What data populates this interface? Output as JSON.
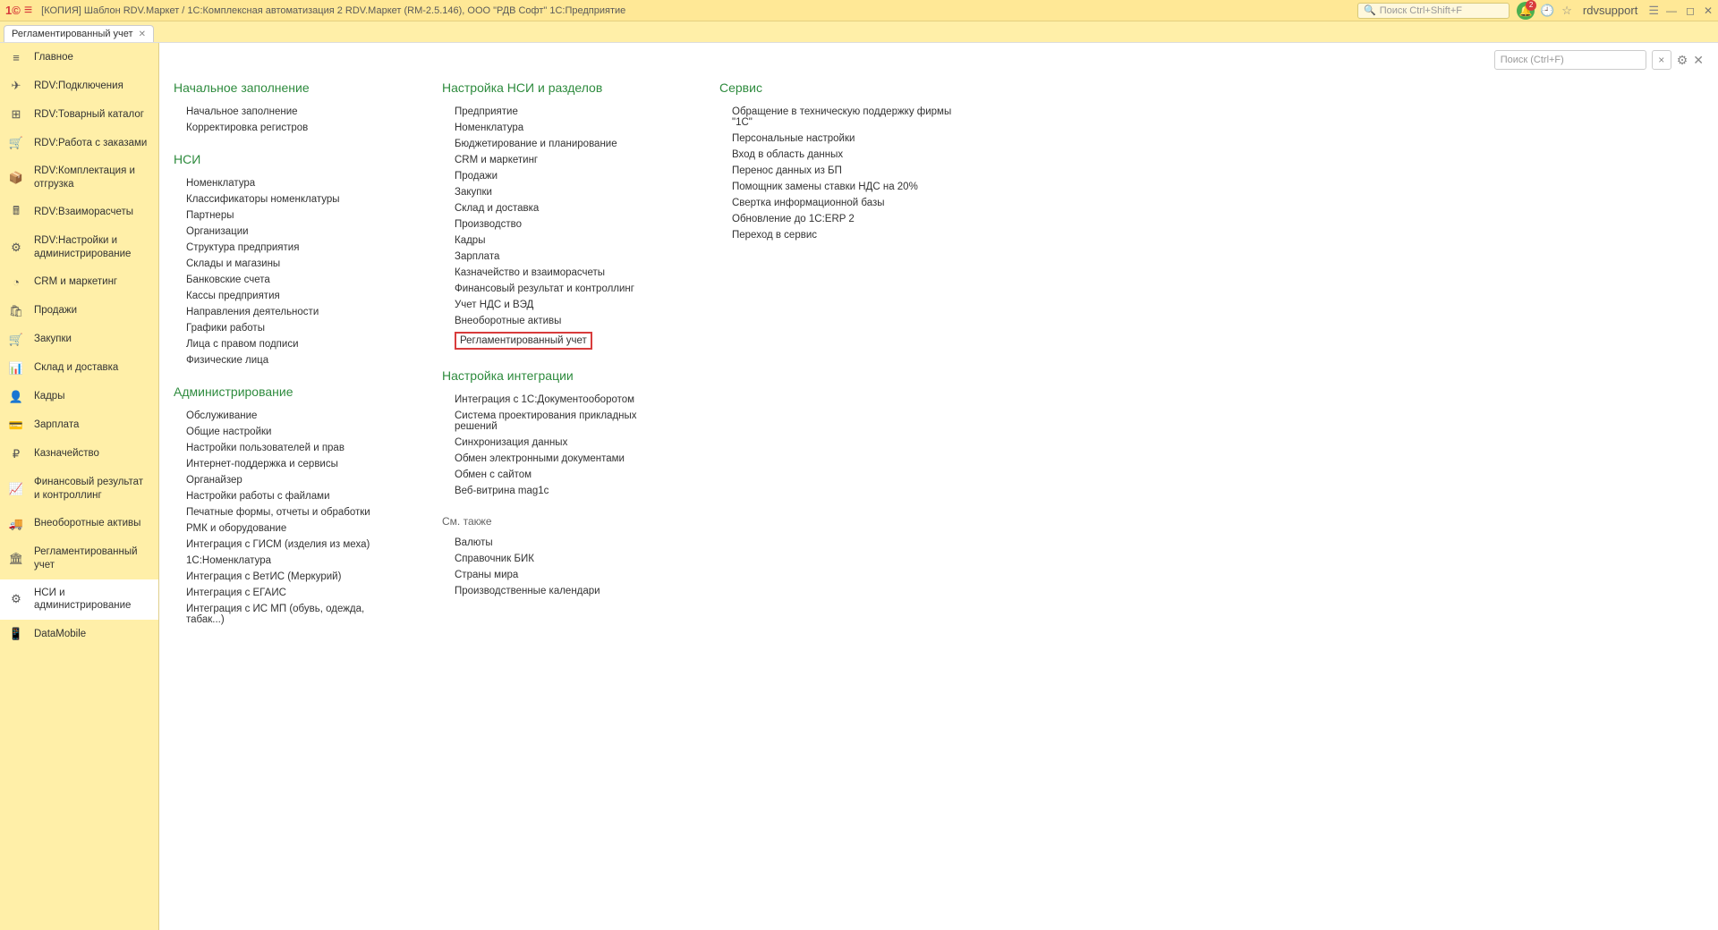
{
  "title": "[КОПИЯ] Шаблон RDV.Маркет / 1С:Комплексная автоматизация 2 RDV.Маркет (RM-2.5.146), ООО \"РДВ Софт\" 1С:Предприятие",
  "searchPlaceholderTop": "Поиск Ctrl+Shift+F",
  "bellBadge": "2",
  "user": "rdvsupport",
  "tab": {
    "label": "Регламентированный учет"
  },
  "contentSearchPlaceholder": "Поиск (Ctrl+F)",
  "sidebar": [
    {
      "label": "Главное",
      "icon": "≡"
    },
    {
      "label": "RDV:Подключения",
      "icon": "✈"
    },
    {
      "label": "RDV:Товарный каталог",
      "icon": "⊞"
    },
    {
      "label": "RDV:Работа с заказами",
      "icon": "🛒"
    },
    {
      "label": "RDV:Комплектация и отгрузка",
      "icon": "📦"
    },
    {
      "label": "RDV:Взаиморасчеты",
      "icon": "🖩"
    },
    {
      "label": "RDV:Настройки и администрирование",
      "icon": "⚙"
    },
    {
      "label": "CRM и маркетинг",
      "icon": "◔"
    },
    {
      "label": "Продажи",
      "icon": "🛍"
    },
    {
      "label": "Закупки",
      "icon": "🛒"
    },
    {
      "label": "Склад и доставка",
      "icon": "📊"
    },
    {
      "label": "Кадры",
      "icon": "👤"
    },
    {
      "label": "Зарплата",
      "icon": "💳"
    },
    {
      "label": "Казначейство",
      "icon": "₽"
    },
    {
      "label": "Финансовый результат и контроллинг",
      "icon": "📈"
    },
    {
      "label": "Внеоборотные активы",
      "icon": "🚚"
    },
    {
      "label": "Регламентированный учет",
      "icon": "🏛"
    },
    {
      "label": "НСИ и администрирование",
      "icon": "⚙"
    },
    {
      "label": "DataMobile",
      "icon": "📱"
    }
  ],
  "sidebarActiveIndex": 17,
  "sections": {
    "col1": [
      {
        "title": "Начальное заполнение",
        "items": [
          "Начальное заполнение",
          "Корректировка регистров"
        ]
      },
      {
        "title": "НСИ",
        "items": [
          "Номенклатура",
          "Классификаторы номенклатуры",
          "Партнеры",
          "Организации",
          "Структура предприятия",
          "Склады и магазины",
          "Банковские счета",
          "Кассы предприятия",
          "Направления деятельности",
          "Графики работы",
          "Лица с правом подписи",
          "Физические лица"
        ]
      },
      {
        "title": "Администрирование",
        "items": [
          "Обслуживание",
          "Общие настройки",
          "Настройки пользователей и прав",
          "Интернет-поддержка и сервисы",
          "Органайзер",
          "Настройки работы с файлами",
          "Печатные формы, отчеты и обработки",
          "РМК и оборудование",
          "Интеграция с ГИСМ (изделия из меха)",
          "1С:Номенклатура",
          "Интеграция с ВетИС (Меркурий)",
          "Интеграция с ЕГАИС",
          "Интеграция с ИС МП (обувь, одежда, табак...)"
        ]
      }
    ],
    "col2": [
      {
        "title": "Настройка НСИ и разделов",
        "items": [
          "Предприятие",
          "Номенклатура",
          "Бюджетирование и планирование",
          "CRM и маркетинг",
          "Продажи",
          "Закупки",
          "Склад и доставка",
          "Производство",
          "Кадры",
          "Зарплата",
          "Казначейство и взаиморасчеты",
          "Финансовый результат и контроллинг",
          "Учет НДС и ВЭД",
          "Внеоборотные активы",
          "Регламентированный учет"
        ]
      },
      {
        "title": "Настройка интеграции",
        "items": [
          "Интеграция с 1С:Документооборотом",
          "Система проектирования прикладных решений",
          "Синхронизация данных",
          "Обмен электронными документами",
          "Обмен с сайтом",
          "Веб-витрина mag1c"
        ]
      }
    ],
    "col2_highlighted": "Регламентированный учет",
    "col2_seeAlso": {
      "label": "См. также",
      "items": [
        "Валюты",
        "Справочник БИК",
        "Страны мира",
        "Производственные календари"
      ]
    },
    "col3": [
      {
        "title": "Сервис",
        "items": [
          "Обращение в техническую поддержку фирмы \"1С\"",
          "Персональные настройки",
          "Вход в область данных",
          "Перенос данных из БП",
          "Помощник замены ставки НДС на 20%",
          "Свертка информационной базы",
          "Обновление до 1С:ERP 2",
          "Переход в сервис"
        ]
      }
    ]
  }
}
